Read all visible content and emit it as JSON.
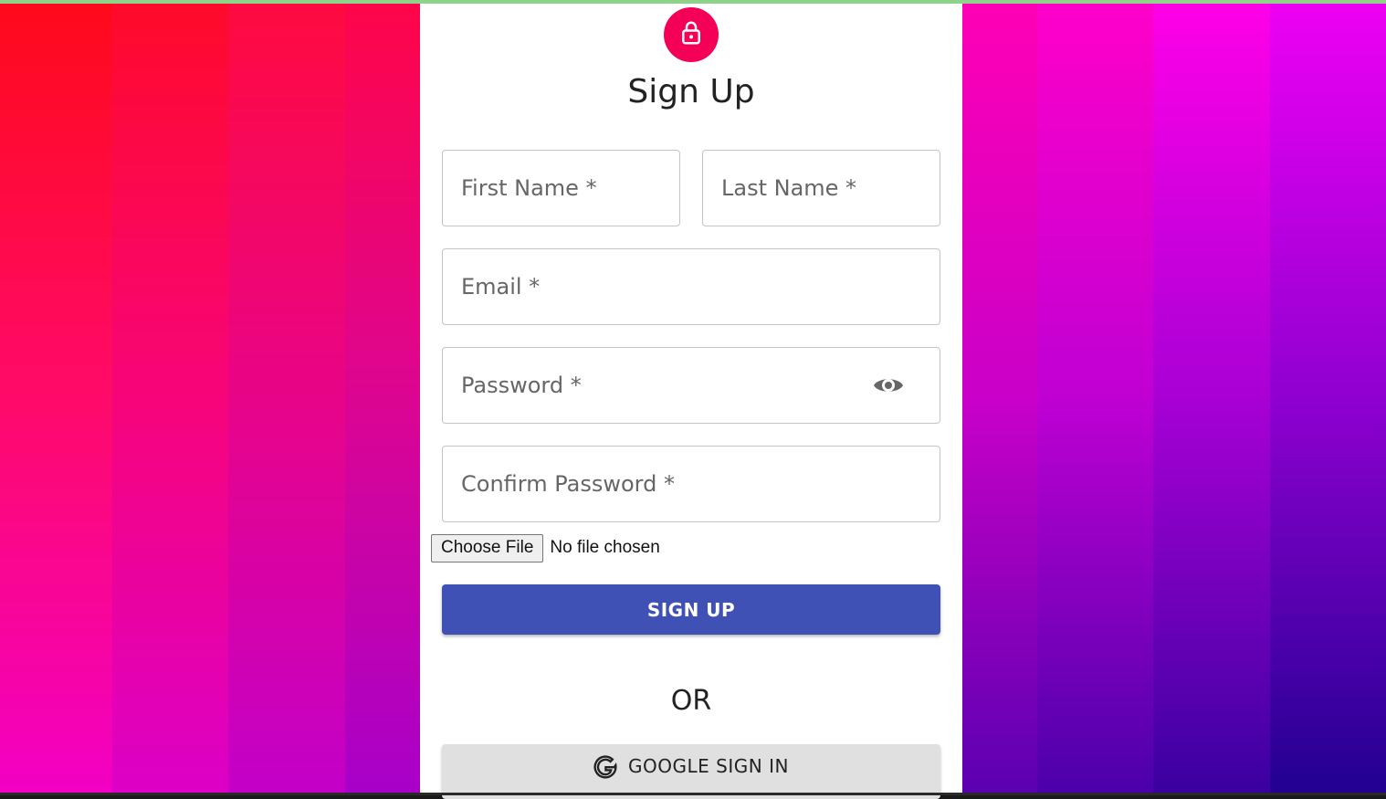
{
  "colors": {
    "avatar": "#f50057",
    "primary_button": "#3f51b5",
    "google_button": "#e0e0e0",
    "field_border": "#c4c4c4"
  },
  "header": {
    "avatar_icon": "lock-icon",
    "title": "Sign Up"
  },
  "form": {
    "first_name_placeholder": "First Name *",
    "last_name_placeholder": "Last Name *",
    "email_placeholder": "Email *",
    "password_placeholder": "Password *",
    "password_toggle_icon": "eye-icon",
    "confirm_password_placeholder": "Confirm Password *",
    "file_button_label": "Choose File",
    "file_status": "No file chosen",
    "submit_label": "SIGN UP"
  },
  "divider_text": "OR",
  "google": {
    "icon": "google-g-icon",
    "label": "GOOGLE SIGN IN"
  }
}
